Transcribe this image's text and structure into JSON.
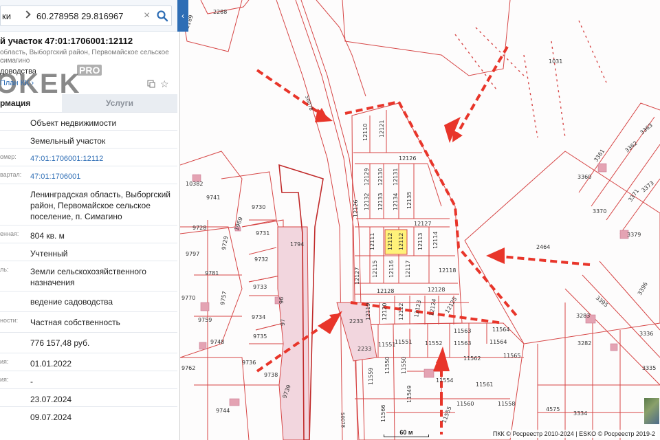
{
  "search": {
    "scope": "ки",
    "value": "60.278958 29.816967",
    "clear_icon": "×"
  },
  "panel": {
    "title": "й участок 47:01:1706001:12112",
    "address": "область, Выборгский район, Первомайское сельское",
    "address2": "симагино",
    "usage": "доводства",
    "plan_link": "План КК",
    "watermark": "OKEK",
    "watermark_pro": "PRO",
    "tabs": {
      "info": "рмация",
      "services": "Услуги"
    },
    "rows": [
      {
        "label": "",
        "value": "Объект недвижимости",
        "link": false
      },
      {
        "label": "",
        "value": "Земельный участок",
        "link": false
      },
      {
        "label": "омер:",
        "value": "47:01:1706001:12112",
        "link": true
      },
      {
        "label": "вартал:",
        "value": "47:01:1706001",
        "link": true
      },
      {
        "label": "",
        "value": "Ленинградская область, Выборгский район, Первомайское сельское поселение, п. Симагино",
        "link": false
      },
      {
        "label": "енная:",
        "value": "804 кв. м",
        "link": false
      },
      {
        "label": "",
        "value": "Учтенный",
        "link": false
      },
      {
        "label": "ль:",
        "value": "Земли сельскохозяйственного назначения",
        "link": false
      },
      {
        "label": "",
        "value": "ведение садоводства",
        "link": false
      },
      {
        "label": "ности:",
        "value": "Частная собственность",
        "link": false
      },
      {
        "label": "",
        "value": "776 157,48 руб.",
        "link": false
      },
      {
        "label": "ия:",
        "value": "01.01.2022",
        "link": false
      },
      {
        "label": "ия:",
        "value": "-",
        "link": false
      },
      {
        "label": "",
        "value": "23.07.2024",
        "link": false
      },
      {
        "label": "",
        "value": "09.07.2024",
        "link": false
      }
    ]
  },
  "map": {
    "attribution": "ПКК © Росреестр 2010-2024 | ESKO © Росреестр 2019-2",
    "scale_label": "60 м",
    "selected_plot": "12112",
    "colors": {
      "boundary": "#d64545",
      "selected": "#fff27a",
      "arrow": "#e8352a",
      "shaded": "#f2d6de"
    },
    "labels": {
      "p2288": "2288",
      "p2189": "2189",
      "p1031": "1031",
      "p12110": "12110",
      "p12121": "12121",
      "p12126": "12126",
      "p12129": "12129",
      "p12130": "12130",
      "p12131": "12131",
      "p12132": "12132",
      "p12133": "12133",
      "p12134": "12134",
      "p12135": "12135",
      "p12127": "12127",
      "p12111": "12111",
      "p12112a": "12112",
      "p12112b": "12112",
      "p12113": "12113",
      "p12114": "12114",
      "p12115": "12115",
      "p12116": "12116",
      "p12117": "12117",
      "p12118": "12118",
      "p12128": "12128",
      "p12119": "12119",
      "p12120": "12120",
      "p12122": "12122",
      "p12123": "12123",
      "p12124": "12124",
      "p12125": "12125",
      "p2233a": "2233",
      "p2233b": "2233",
      "p11551": "11551",
      "p11551b": "11551",
      "p11552": "11552",
      "p11563": "11563",
      "p11563b": "11563",
      "p11564": "11564",
      "p11564b": "11564",
      "p11565": "11565",
      "p11562": "11562",
      "p11559": "11559",
      "p11550": "11550",
      "p11554": "11554",
      "p11549": "11549",
      "p11561": "11561",
      "p11560": "11560",
      "p11558": "11558",
      "p11566": "11566",
      "p11555": "11555",
      "p2464": "2464",
      "p3363": "3363",
      "p3362": "3362",
      "p3361": "3361",
      "p3360": "3360",
      "p3373": "3373",
      "p3371": "3371",
      "p3370": "3370",
      "p3379": "3379",
      "p3396": "3396",
      "p3395": "3395",
      "p3283": "3283",
      "p3282": "3282",
      "p3336": "3336",
      "p3335": "3335",
      "p3334": "3334",
      "p4575": "4575",
      "p10382": "10382",
      "p9741": "9741",
      "p9730": "9730",
      "p9728": "9728",
      "p9731": "9731",
      "p1794": "1794",
      "p9729": "9729",
      "p9797": "9797",
      "p9732": "9732",
      "p9781": "9781",
      "p9733": "9733",
      "p9770": "9770",
      "p9757": "9757",
      "p96": "96",
      "p9759": "9759",
      "p9734": "9734",
      "p97": "97",
      "p9735": "9735",
      "p9748": "9748",
      "p9736": "9736",
      "p9738": "9738",
      "p9762": "9762",
      "p9739": "9739",
      "p9744": "9744",
      "p50078a": "50078",
      "p50078b": "50078",
      "p1969": "1969"
    }
  }
}
